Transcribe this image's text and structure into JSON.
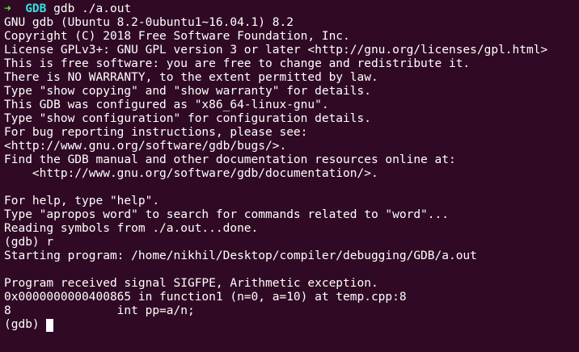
{
  "prompt": {
    "arrow": "➜",
    "dir": "GDB",
    "command": "gdb ./a.out"
  },
  "output_lines": [
    "GNU gdb (Ubuntu 8.2-0ubuntu1~16.04.1) 8.2",
    "Copyright (C) 2018 Free Software Foundation, Inc.",
    "License GPLv3+: GNU GPL version 3 or later <http://gnu.org/licenses/gpl.html>",
    "This is free software: you are free to change and redistribute it.",
    "There is NO WARRANTY, to the extent permitted by law.",
    "Type \"show copying\" and \"show warranty\" for details.",
    "This GDB was configured as \"x86_64-linux-gnu\".",
    "Type \"show configuration\" for configuration details.",
    "For bug reporting instructions, please see:",
    "<http://www.gnu.org/software/gdb/bugs/>.",
    "Find the GDB manual and other documentation resources online at:",
    "    <http://www.gnu.org/software/gdb/documentation/>.",
    "",
    "For help, type \"help\".",
    "Type \"apropos word\" to search for commands related to \"word\"...",
    "Reading symbols from ./a.out...done.",
    "(gdb) r",
    "Starting program: /home/nikhil/Desktop/compiler/debugging/GDB/a.out",
    "",
    "Program received signal SIGFPE, Arithmetic exception.",
    "0x0000000000400865 in function1 (n=0, a=10) at temp.cpp:8",
    "8               int pp=a/n;"
  ],
  "current_prompt": "(gdb) ",
  "colors": {
    "background": "#300a24",
    "foreground": "#ffffff",
    "arrow": "#4ee94e",
    "dir": "#34e2e2"
  }
}
